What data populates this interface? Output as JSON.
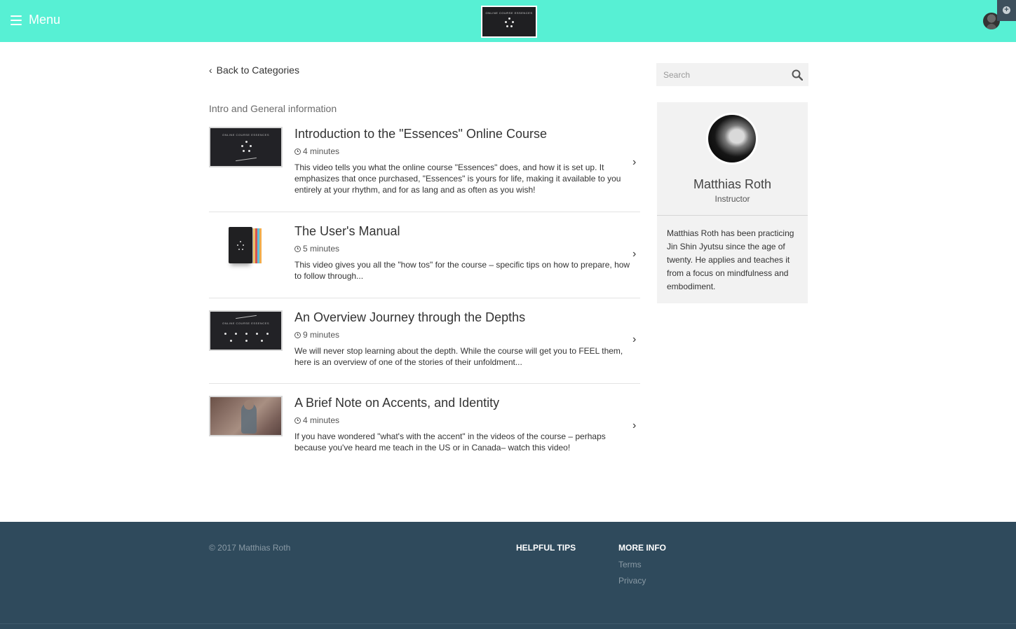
{
  "header": {
    "menu_label": "Menu",
    "logo_text": "ONLINE COURSE ESSENCES",
    "brand_color": "#57f0d4"
  },
  "main": {
    "back_link": "Back to Categories",
    "section_title": "Intro and General information",
    "lessons": [
      {
        "title": "Introduction to the \"Essences\" Online Course",
        "duration": "4 minutes",
        "description": "This video tells you what the online course \"Essences\" does, and how it is set up. It emphasizes that once purchased, \"Essences\" is yours for life, making it available to you entirely at your rhythm, and for as lang and as often as you wish!",
        "thumb_text": "ONLINE COURSE ESSENCES"
      },
      {
        "title": "The User's Manual",
        "duration": "5 minutes",
        "description": "This video gives you all the \"how tos\" for the course – specific tips on how to prepare, how to follow through..."
      },
      {
        "title": "An Overview Journey through the Depths",
        "duration": "9 minutes",
        "description": "We will never stop learning about the depth. While the course will get you to FEEL them, here is an overview of one of the stories of their unfoldment...",
        "thumb_text": "ONLINE COURSE ESSENCES"
      },
      {
        "title": "A Brief Note on Accents, and Identity",
        "duration": "4 minutes",
        "description": "If you have wondered \"what's with the accent\" in the videos of the course – perhaps because you've heard me teach in the US or in Canada– watch this video!"
      }
    ]
  },
  "sidebar": {
    "search_placeholder": "Search",
    "instructor": {
      "name": "Matthias Roth",
      "role": "Instructor",
      "bio": "Matthias Roth has been practicing Jin Shin Jyutsu since the age of twenty. He applies and teaches it from a focus on mindfulness and embodiment."
    }
  },
  "footer": {
    "copyright": "© 2017 Matthias Roth",
    "helpful_tips": "HELPFUL TIPS",
    "more_info": "MORE INFO",
    "links": [
      "Terms",
      "Privacy"
    ],
    "background_color": "#2f4a5c"
  }
}
